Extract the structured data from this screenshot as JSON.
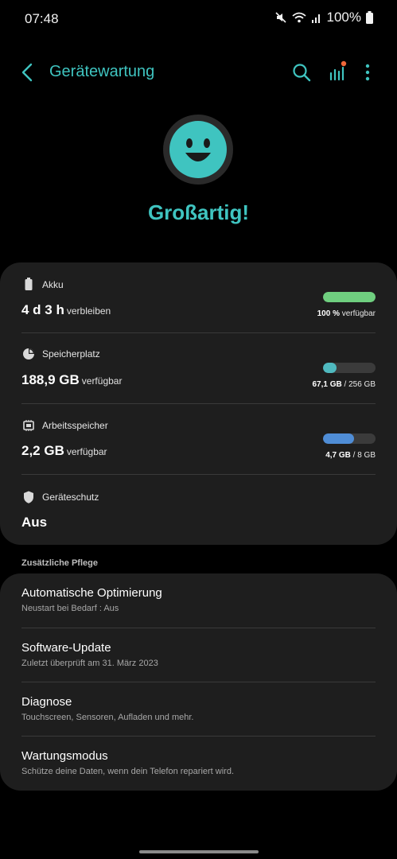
{
  "status_bar": {
    "time": "07:48",
    "battery_percent": "100%",
    "icons": [
      "mute-icon",
      "wifi-icon",
      "signal-icon",
      "battery-icon"
    ]
  },
  "app_bar": {
    "title": "Gerätewartung",
    "actions": [
      "search-icon",
      "stats-icon",
      "more-icon"
    ]
  },
  "hero": {
    "status_text": "Großartig!"
  },
  "overview": {
    "battery": {
      "label": "Akku",
      "value": "4 d 3 h",
      "unit": "verbleiben",
      "bar_fraction": 1.0,
      "bar_color": "#6fcf7f",
      "caption_bold": "100 %",
      "caption_rest": " verfügbar"
    },
    "storage": {
      "label": "Speicherplatz",
      "value": "188,9 GB",
      "unit": "verfügbar",
      "bar_fraction": 0.26,
      "bar_color": "#4fb9bf",
      "caption_bold": "67,1 GB",
      "caption_rest": " / 256 GB"
    },
    "memory": {
      "label": "Arbeitsspeicher",
      "value": "2,2 GB",
      "unit": "verfügbar",
      "bar_fraction": 0.59,
      "bar_color": "#4f8dd6",
      "caption_bold": "4,7 GB",
      "caption_rest": " / 8 GB"
    },
    "protection": {
      "label": "Geräteschutz",
      "value": "Aus"
    }
  },
  "additional": {
    "header": "Zusätzliche Pflege",
    "items": [
      {
        "title": "Automatische Optimierung",
        "subtitle": "Neustart bei Bedarf : Aus"
      },
      {
        "title": "Software-Update",
        "subtitle": "Zuletzt überprüft am 31. März 2023"
      },
      {
        "title": "Diagnose",
        "subtitle": "Touchscreen, Sensoren, Aufladen und mehr."
      },
      {
        "title": "Wartungsmodus",
        "subtitle": "Schütze deine Daten, wenn dein Telefon repariert wird."
      }
    ]
  },
  "colors": {
    "accent": "#3fc4c0",
    "background": "#000000",
    "card": "#1e1e1e",
    "notification_dot": "#f0683a"
  }
}
